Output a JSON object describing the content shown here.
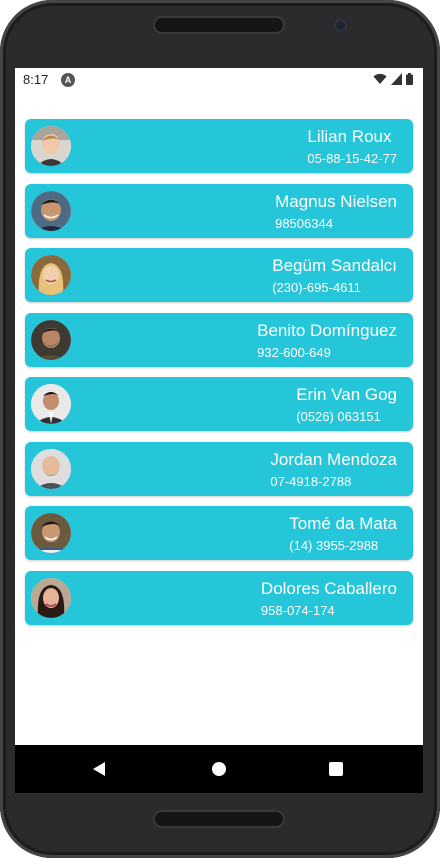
{
  "status_bar": {
    "time": "8:17",
    "app_icon_glyph": "A"
  },
  "contacts": [
    {
      "name": "Lilian Roux",
      "phone": "05-88-15-42-77",
      "avatar_icon": "avatar-photo-man-light-hair"
    },
    {
      "name": "Magnus Nielsen",
      "phone": "98506344",
      "avatar_icon": "avatar-photo-man-dark-hair"
    },
    {
      "name": "Begüm Sandalcı",
      "phone": "(230)-695-4611",
      "avatar_icon": "avatar-photo-woman-blonde"
    },
    {
      "name": "Benito Domínguez",
      "phone": "932-600-649",
      "avatar_icon": "avatar-photo-man-beard"
    },
    {
      "name": "Erin Van Gog",
      "phone": "(0526) 063151",
      "avatar_icon": "avatar-photo-man-suit"
    },
    {
      "name": "Jordan Mendoza",
      "phone": "07-4918-2788",
      "avatar_icon": "avatar-photo-man-bald"
    },
    {
      "name": "Tomé da Mata",
      "phone": "(14) 3955-2988",
      "avatar_icon": "avatar-photo-man-smiling"
    },
    {
      "name": "Dolores Caballero",
      "phone": "958-074-174",
      "avatar_icon": "avatar-photo-woman-dark-hair"
    }
  ],
  "colors": {
    "card_background": "#26c6da",
    "card_text": "#ffffff",
    "nav_bar": "#000000"
  }
}
